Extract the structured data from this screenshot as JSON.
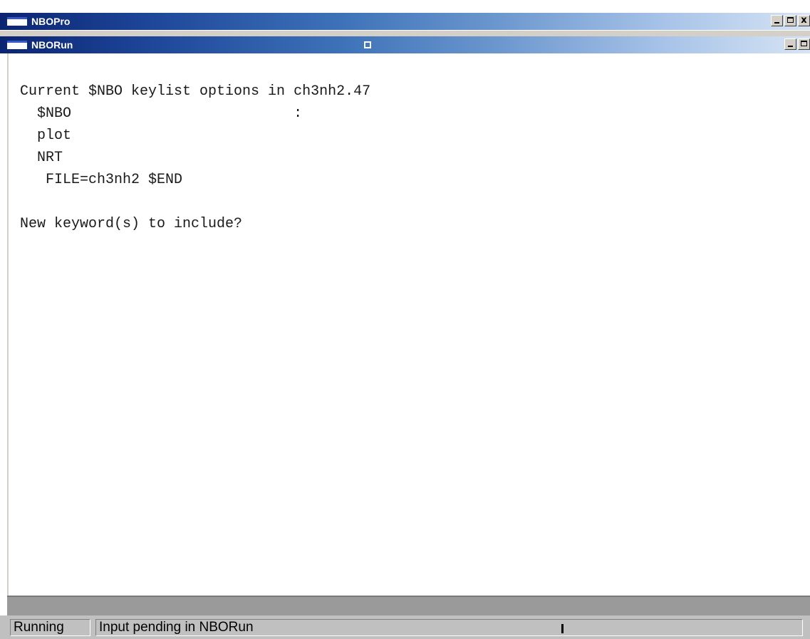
{
  "outer_window": {
    "title": "NBOPro",
    "controls": {
      "minimize": "_",
      "maximize": "□",
      "close": "x"
    }
  },
  "inner_window": {
    "title": "NBORun",
    "controls": {
      "minimize": "_",
      "maximize": "□"
    }
  },
  "console": {
    "lines": [
      "Current $NBO keylist options in ch3nh2.47",
      "  $NBO                          :",
      "  plot",
      "  NRT",
      "   FILE=ch3nh2 $END",
      "",
      "New keyword(s) to include?"
    ]
  },
  "statusbar": {
    "state": "Running",
    "message": "Input pending in NBORun"
  },
  "colors": {
    "titlebar_start": "#0b2472",
    "titlebar_end": "#d6e4f4",
    "console_bg": "#ffffff",
    "statusbar_bg": "#c0c0c0"
  }
}
